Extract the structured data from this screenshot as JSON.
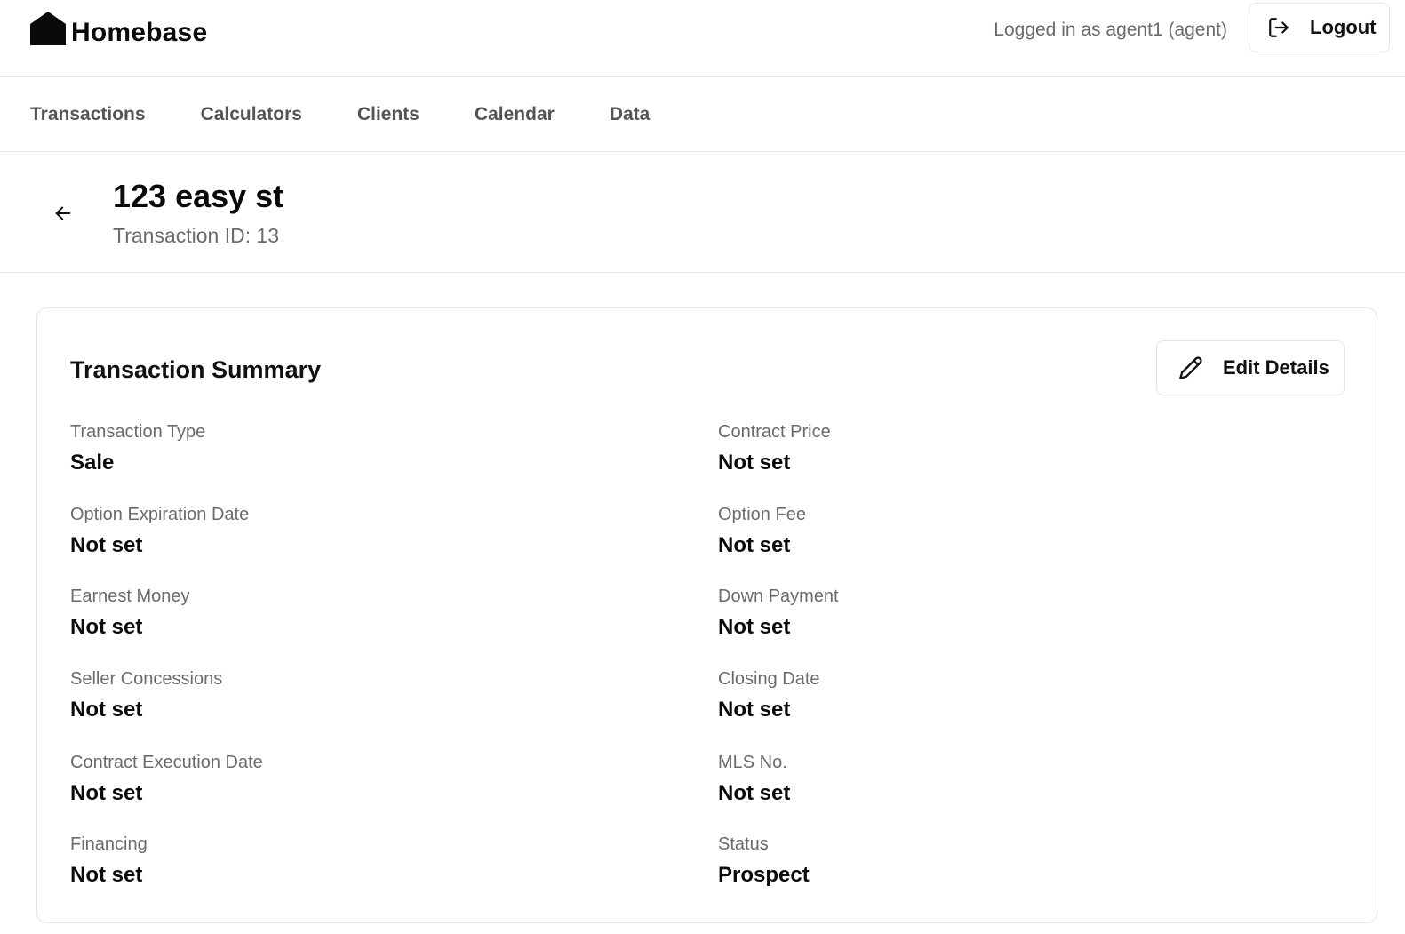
{
  "app": {
    "name": "Homebase",
    "logo_icon": "house-icon"
  },
  "header": {
    "user_text": "Logged in as agent1 (agent)",
    "logout_label": "Logout",
    "logout_icon": "logout-icon"
  },
  "nav": {
    "items": [
      {
        "label": "Transactions"
      },
      {
        "label": "Calculators"
      },
      {
        "label": "Clients"
      },
      {
        "label": "Calendar"
      },
      {
        "label": "Data"
      }
    ]
  },
  "page": {
    "back_icon": "arrow-left-icon",
    "title": "123 easy st",
    "subtitle": "Transaction ID: 13"
  },
  "summary": {
    "title": "Transaction Summary",
    "edit_label": "Edit Details",
    "edit_icon": "pencil-icon",
    "fields": [
      {
        "label": "Transaction Type",
        "value": "Sale"
      },
      {
        "label": "Contract Price",
        "value": "Not set"
      },
      {
        "label": "Option Expiration Date",
        "value": "Not set"
      },
      {
        "label": "Option Fee",
        "value": "Not set"
      },
      {
        "label": "Earnest Money",
        "value": "Not set"
      },
      {
        "label": "Down Payment",
        "value": "Not set"
      },
      {
        "label": "Seller Concessions",
        "value": "Not set"
      },
      {
        "label": "Closing Date",
        "value": "Not set"
      },
      {
        "label": "Contract Execution Date",
        "value": "Not set"
      },
      {
        "label": "MLS No.",
        "value": "Not set"
      },
      {
        "label": "Financing",
        "value": "Not set"
      },
      {
        "label": "Status",
        "value": "Prospect"
      }
    ]
  }
}
